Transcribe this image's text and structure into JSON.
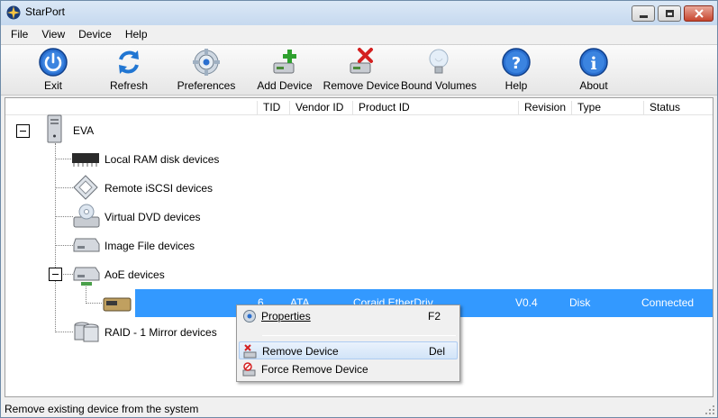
{
  "window": {
    "title": "StarPort"
  },
  "menu": [
    "File",
    "View",
    "Device",
    "Help"
  ],
  "toolbar": [
    {
      "label": "Exit",
      "icon": "power-icon"
    },
    {
      "label": "Refresh",
      "icon": "refresh-icon"
    },
    {
      "label": "Preferences",
      "icon": "gear-icon"
    },
    {
      "label": "Add Device",
      "icon": "add-device-icon"
    },
    {
      "label": "Remove Device",
      "icon": "remove-device-icon"
    },
    {
      "label": "Bound Volumes",
      "icon": "lightbulb-icon"
    },
    {
      "label": "Help",
      "icon": "help-icon"
    },
    {
      "label": "About",
      "icon": "info-icon"
    }
  ],
  "columns": [
    "TID",
    "Vendor ID",
    "Product ID",
    "Revision",
    "Type",
    "Status"
  ],
  "tree": {
    "root": "EVA",
    "nodes": [
      "Local RAM disk devices",
      "Remote iSCSI devices",
      "Virtual DVD devices",
      "Image File devices",
      "AoE devices",
      "RAID - 1 Mirror devices"
    ]
  },
  "device": {
    "tid": "6",
    "vendor": "ATA",
    "product": "Coraid EtherDriv",
    "revision": "V0.4",
    "type": "Disk",
    "status": "Connected"
  },
  "context_menu": [
    {
      "label": "Properties",
      "shortcut": "F2"
    },
    {
      "label": "Remove Device",
      "shortcut": "Del"
    },
    {
      "label": "Force Remove Device",
      "shortcut": ""
    }
  ],
  "status_bar": "Remove existing device from the system",
  "colors": {
    "selection": "#3399ff",
    "accent": "#2a6fcf"
  }
}
